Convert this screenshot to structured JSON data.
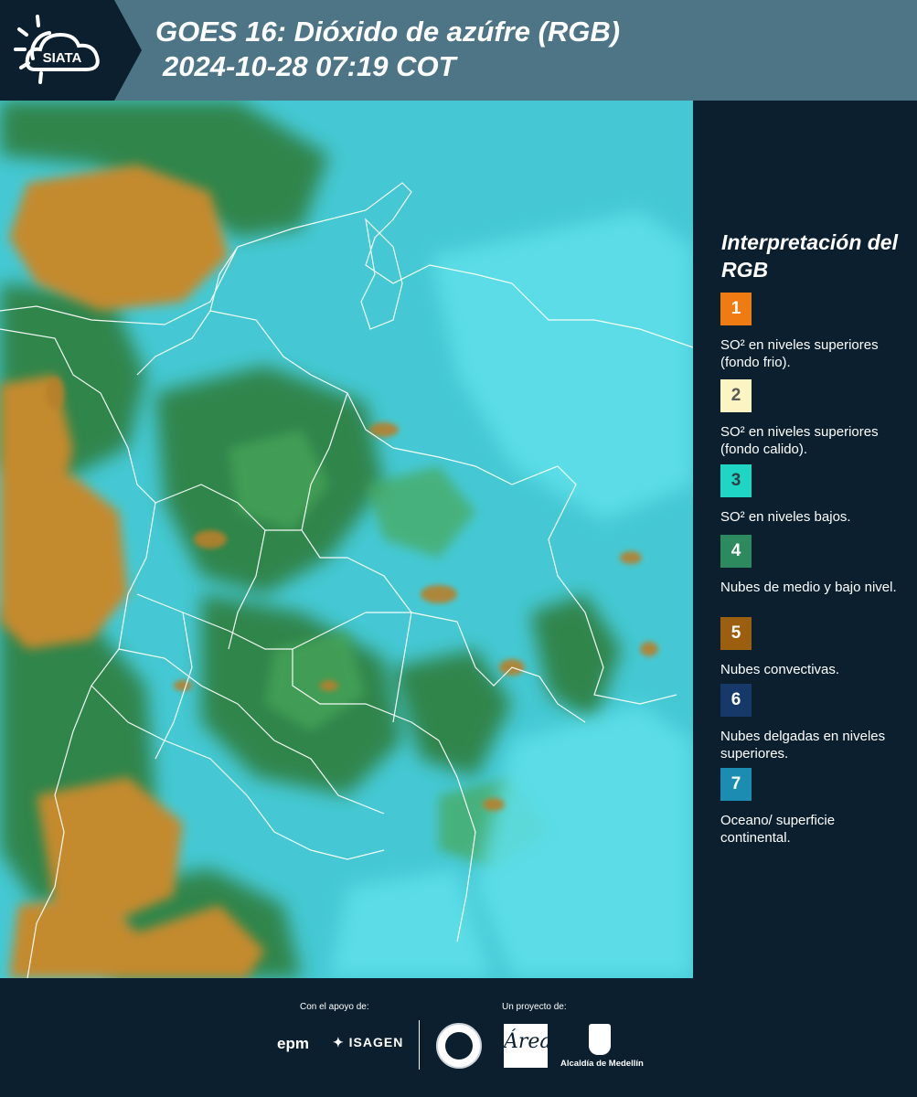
{
  "header": {
    "brand": "SIATA",
    "title_line1": "GOES 16: Dióxido de azúfre (RGB)",
    "title_line2": "2024-10-28 07:19 COT",
    "background_color": "#4d7585",
    "logo_background_color": "#0b1f2e"
  },
  "legend": {
    "title": "Interpretación del RGB",
    "items": [
      {
        "number": "1",
        "text": "SO² en niveles superiores (fondo frio).",
        "color": "#f07b12",
        "number_color": "#ffffff"
      },
      {
        "number": "2",
        "text": "SO² en niveles superiores (fondo calido).",
        "color": "#fbf5c3",
        "number_color": "#5a5a5a"
      },
      {
        "number": "3",
        "text": "SO² en niveles bajos.",
        "color": "#1fd6c4",
        "number_color": "#2f3f47"
      },
      {
        "number": "4",
        "text": "Nubes de medio y bajo nivel.",
        "color": "#2d8a5e",
        "number_color": "#ffffff"
      },
      {
        "number": "5",
        "text": "Nubes convectivas.",
        "color": "#9c5f0f",
        "number_color": "#ffffff"
      },
      {
        "number": "6",
        "text": "Nubes delgadas en niveles superiores.",
        "color": "#16396a",
        "number_color": "#ffffff"
      },
      {
        "number": "7",
        "text": "Oceano/ superficie continental.",
        "color": "#1d8cb3",
        "number_color": "#ffffff"
      }
    ]
  },
  "footer": {
    "support_label": "Con el apoyo de:",
    "project_label": "Un proyecto de:",
    "sponsor_1": "epm",
    "sponsor_2": "ISAGEN",
    "partner_1": "Área",
    "partner_2": "Alcaldía de Medellín"
  }
}
